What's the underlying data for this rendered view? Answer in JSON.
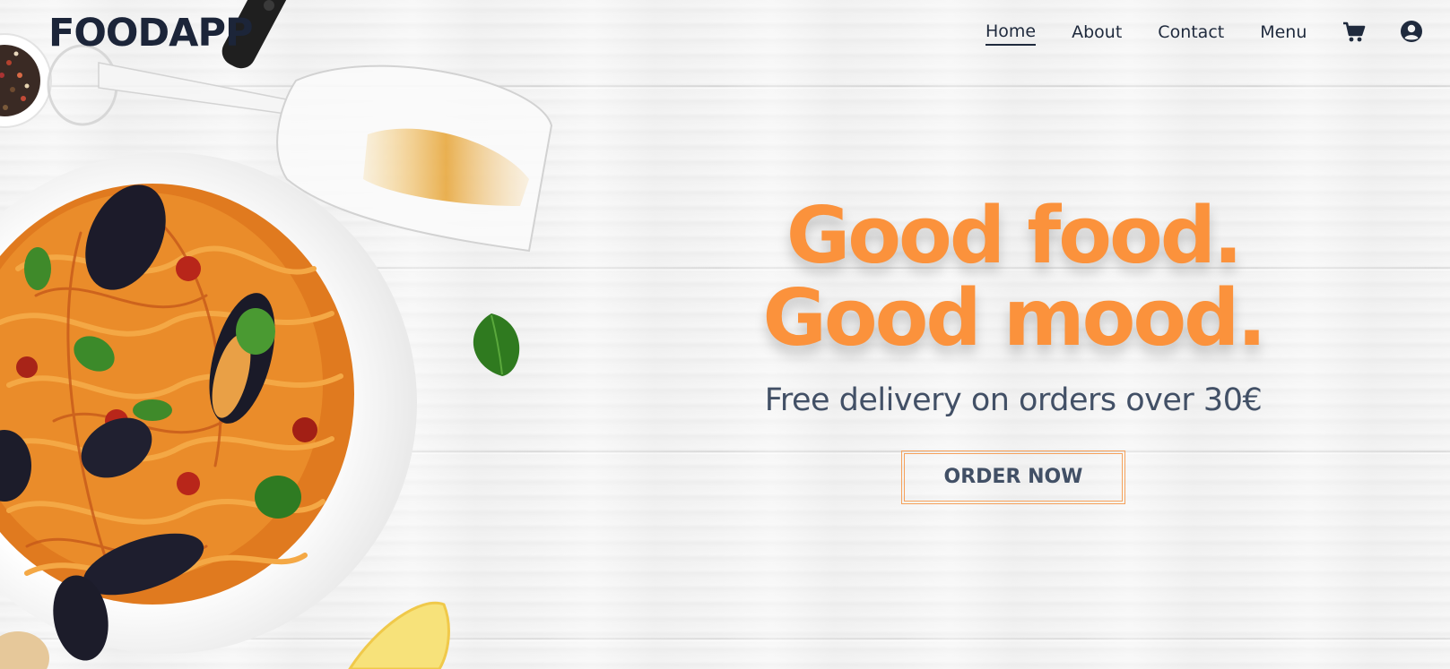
{
  "header": {
    "logo": "FOODAPP",
    "nav": [
      {
        "label": "Home",
        "active": true
      },
      {
        "label": "About",
        "active": false
      },
      {
        "label": "Contact",
        "active": false
      },
      {
        "label": "Menu",
        "active": false
      }
    ],
    "icons": [
      "cart-icon",
      "user-account-icon"
    ]
  },
  "hero": {
    "headline_line1": "Good food.",
    "headline_line2": "Good mood.",
    "subtitle": "Free delivery on orders over 30€",
    "cta_label": "ORDER NOW"
  },
  "colors": {
    "accent": "#fb923c",
    "text_dark": "#1c2539",
    "text_muted": "#425066",
    "background": "#f2f2f2"
  }
}
